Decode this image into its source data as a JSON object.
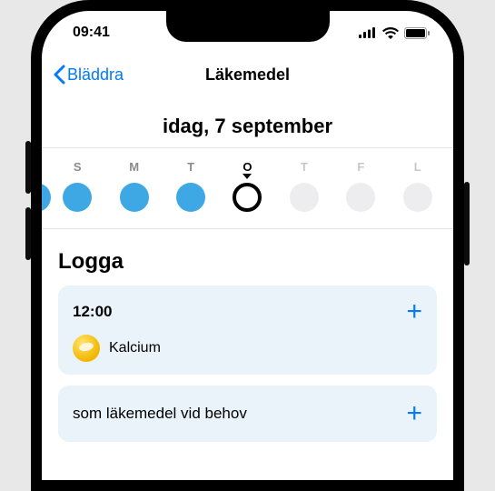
{
  "status": {
    "time": "09:41"
  },
  "nav": {
    "back_label": "Bläddra",
    "title": "Läkemedel"
  },
  "date_header": "idag, 7 september",
  "week": {
    "days": [
      {
        "letter": "S",
        "state": "filled"
      },
      {
        "letter": "M",
        "state": "filled"
      },
      {
        "letter": "T",
        "state": "filled"
      },
      {
        "letter": "O",
        "state": "today"
      },
      {
        "letter": "T",
        "state": "future"
      },
      {
        "letter": "F",
        "state": "future"
      },
      {
        "letter": "L",
        "state": "future"
      }
    ]
  },
  "log": {
    "title": "Logga",
    "entries": [
      {
        "time": "12:00",
        "med_name": "Kalcium"
      }
    ],
    "as_needed_label": "som läkemedel vid behov"
  }
}
